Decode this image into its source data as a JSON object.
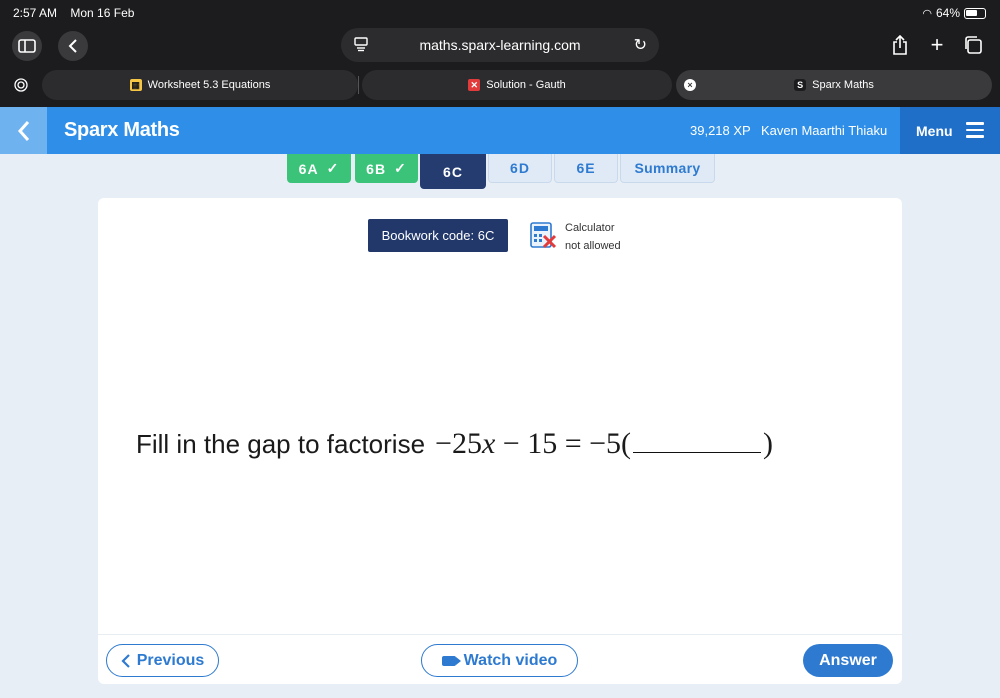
{
  "status_bar": {
    "time": "2:57 AM",
    "date": "Mon 16 Feb",
    "battery": "64%"
  },
  "browser": {
    "url": "maths.sparx-learning.com"
  },
  "tabs": [
    {
      "label": "Worksheet 5.3 Equations",
      "active": false
    },
    {
      "label": "Solution - Gauth",
      "active": false
    },
    {
      "label": "Sparx Maths",
      "active": true
    }
  ],
  "header": {
    "brand": "Sparx Maths",
    "xp": "39,218 XP",
    "user": "Kaven Maarthi Thiaku",
    "menu": "Menu"
  },
  "task_tabs": [
    {
      "label": "6A",
      "state": "done"
    },
    {
      "label": "6B",
      "state": "done"
    },
    {
      "label": "6C",
      "state": "current"
    },
    {
      "label": "6D",
      "state": "todo"
    },
    {
      "label": "6E",
      "state": "todo"
    },
    {
      "label": "Summary",
      "state": "todo"
    }
  ],
  "card": {
    "bookwork": "Bookwork code: 6C",
    "calculator_line1": "Calculator",
    "calculator_line2": "not allowed",
    "question_text": "Fill in the gap to factorise",
    "math_lhs_coef": "−25",
    "math_var": "x",
    "math_rest": " − 15 = −5(",
    "math_close": ")"
  },
  "footer": {
    "previous": "Previous",
    "watch_video": "Watch video",
    "answer": "Answer"
  },
  "colors": {
    "brand_blue": "#2e8ee8",
    "done_green": "#3cc37a",
    "navy": "#22386a"
  }
}
